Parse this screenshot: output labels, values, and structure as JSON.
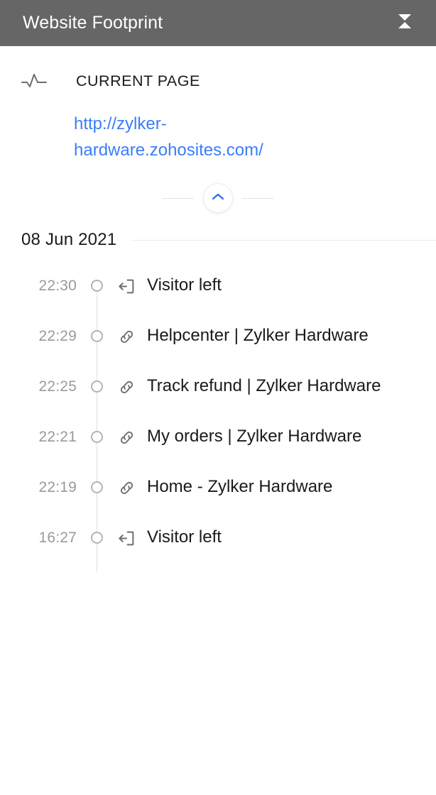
{
  "window": {
    "title": "Website Footprint",
    "close_icon": "close-x-icon",
    "header_bg": "#666666",
    "header_text_color": "#ffffff"
  },
  "current_page": {
    "icon": "pulse-activity-icon",
    "label": "CURRENT PAGE",
    "url": "http://zylker-hardware.zohosites.com/",
    "url_color": "#3a7dfa"
  },
  "collapse": {
    "icon": "chevron-up-icon",
    "accent_color": "#2f6fe0"
  },
  "timeline": {
    "date": "08 Jun 2021",
    "events": [
      {
        "time": "22:30",
        "icon": "exit-logout-icon",
        "text": "Visitor left"
      },
      {
        "time": "22:29",
        "icon": "link-chain-icon",
        "text": "Helpcenter | Zylker Hardware"
      },
      {
        "time": "22:25",
        "icon": "link-chain-icon",
        "text": "Track refund | Zylker Hardware"
      },
      {
        "time": "22:21",
        "icon": "link-chain-icon",
        "text": "My orders | Zylker Hardware"
      },
      {
        "time": "22:19",
        "icon": "link-chain-icon",
        "text": "Home - Zylker Hardware"
      },
      {
        "time": "16:27",
        "icon": "exit-logout-icon",
        "text": "Visitor left"
      }
    ]
  }
}
